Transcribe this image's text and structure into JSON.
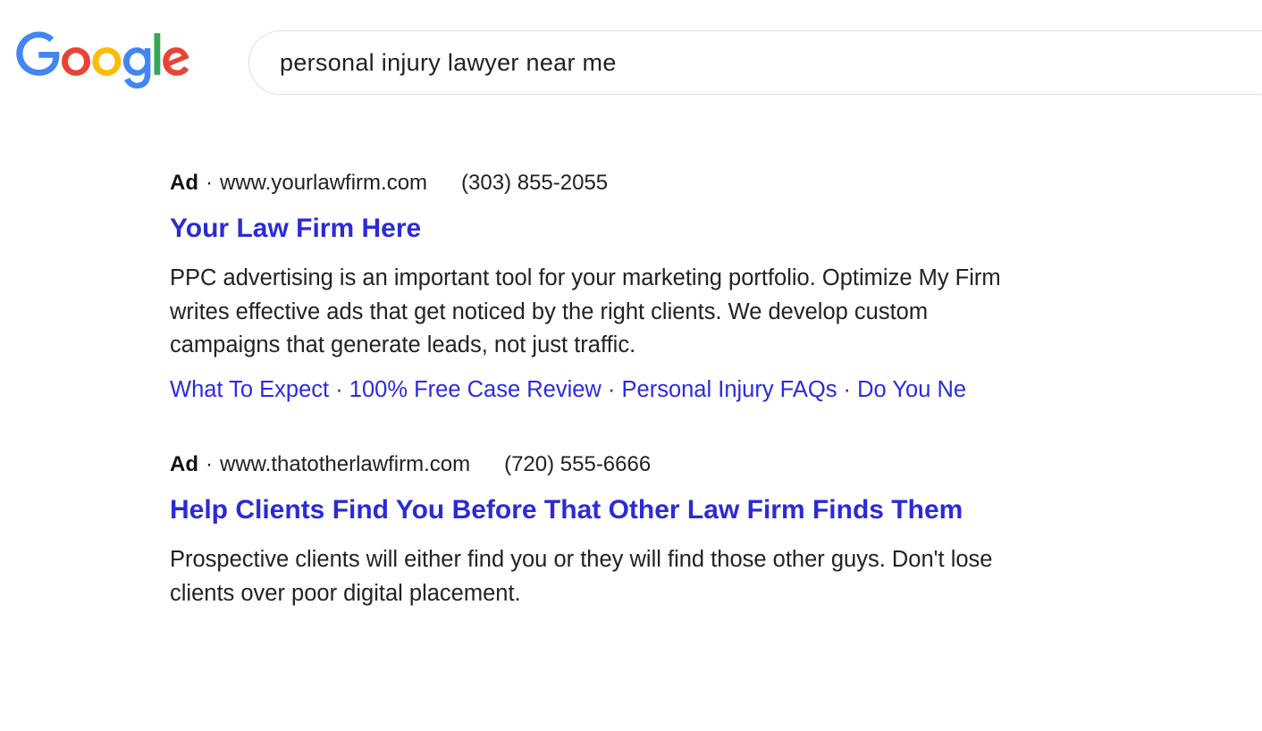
{
  "search": {
    "query": "personal injury lawyer near me"
  },
  "results": [
    {
      "ad_label": "Ad",
      "dot": "·",
      "url": "www.yourlawfirm.com",
      "phone": "(303) 855-2055",
      "title": "Your Law Firm Here",
      "description": "PPC advertising is an important tool for your marketing portfolio. Optimize My Firm writes effective ads that get noticed by the right clients. We develop custom campaigns that generate leads, not just traffic.",
      "sitelinks": {
        "l0": "What To Expect",
        "l1": "100% Free Case Review",
        "l2": "Personal Injury FAQs",
        "l3": "Do You Ne"
      }
    },
    {
      "ad_label": "Ad",
      "dot": "·",
      "url": "www.thatotherlawfirm.com",
      "phone": "(720) 555-6666",
      "title": "Help Clients Find You Before That Other Law Firm Finds Them",
      "description": "Prospective clients will either find you or they will find those other guys. Don't lose clients over poor digital placement."
    }
  ],
  "sitelink_sep": " · "
}
